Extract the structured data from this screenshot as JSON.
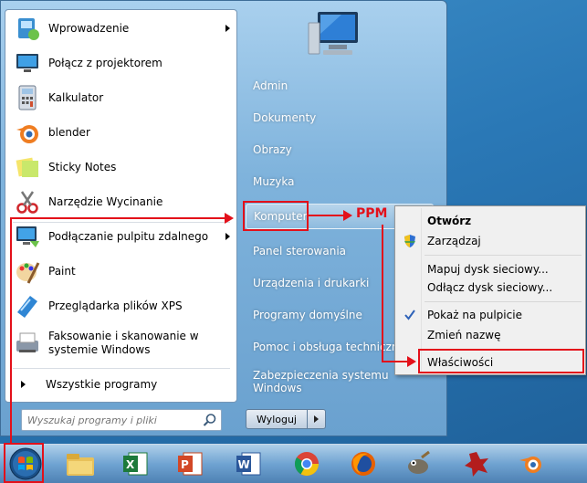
{
  "start_menu": {
    "programs": [
      {
        "label": "Wprowadzenie",
        "icon": "getting-started-icon",
        "submenu": true
      },
      {
        "label": "Połącz z projektorem",
        "icon": "projector-icon",
        "submenu": false
      },
      {
        "label": "Kalkulator",
        "icon": "calculator-icon",
        "submenu": false
      },
      {
        "label": "blender",
        "icon": "blender-icon",
        "submenu": false
      },
      {
        "label": "Sticky Notes",
        "icon": "sticky-notes-icon",
        "submenu": false
      },
      {
        "label": "Narzędzie Wycinanie",
        "icon": "snipping-tool-icon",
        "submenu": false
      },
      {
        "label": "Podłączanie pulpitu zdalnego",
        "icon": "remote-desktop-icon",
        "submenu": true
      },
      {
        "label": "Paint",
        "icon": "paint-icon",
        "submenu": false
      },
      {
        "label": "Przeglądarka plików XPS",
        "icon": "xps-viewer-icon",
        "submenu": false
      },
      {
        "label_line1": "Faksowanie i skanowanie w",
        "label_line2": "systemie Windows",
        "icon": "fax-scan-icon",
        "submenu": false
      }
    ],
    "all_programs": "Wszystkie programy",
    "search_placeholder": "Wyszukaj programy i pliki",
    "right_items": [
      "Admin",
      "Dokumenty",
      "Obrazy",
      "Muzyka",
      "Komputer",
      "Panel sterowania",
      "Urządzenia i drukarki",
      "Programy domyślne",
      "Pomoc i obsługa techniczna",
      "Zabezpieczenia systemu Windows"
    ],
    "shutdown_label": "Wyloguj"
  },
  "context_menu": {
    "items": [
      {
        "label": "Otwórz",
        "bold": true
      },
      {
        "label": "Zarządzaj",
        "bold": false,
        "icon": "shield-icon"
      },
      {
        "label": "Mapuj dysk sieciowy...",
        "bold": false
      },
      {
        "label": "Odłącz dysk sieciowy...",
        "bold": false
      },
      {
        "label": "Pokaż na pulpicie",
        "bold": false,
        "checked": true
      },
      {
        "label": "Zmień nazwę",
        "bold": false
      },
      {
        "label": "Właściwości",
        "bold": false
      }
    ]
  },
  "annotation": {
    "label": "PPM",
    "color": "#e3101a"
  },
  "taskbar": {
    "apps": [
      "explorer-icon",
      "excel-icon",
      "powerpoint-icon",
      "word-icon",
      "chrome-icon",
      "firefox-icon",
      "gimp-icon",
      "app-icon",
      "blender-icon"
    ]
  },
  "colors": {
    "accent_red": "#e3101a",
    "menu_blue": "#7fb3dc"
  }
}
